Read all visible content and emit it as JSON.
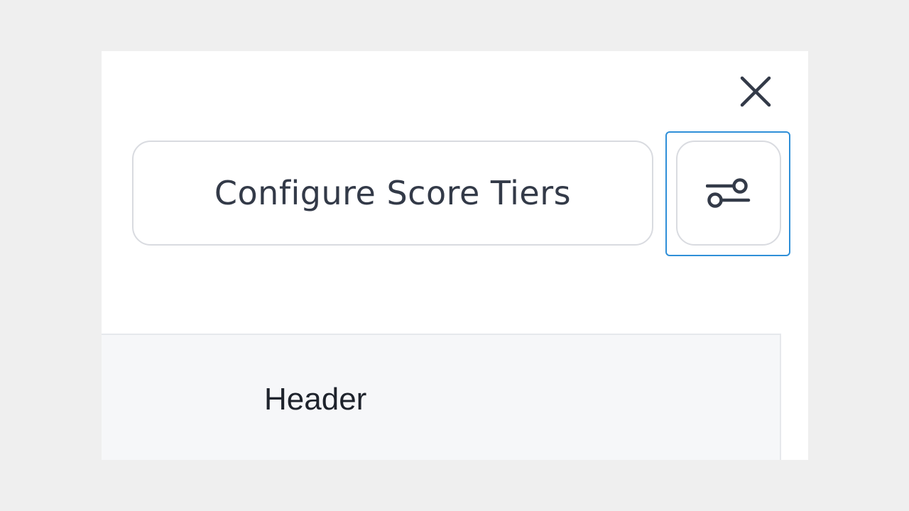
{
  "dialog": {
    "close_icon": "close-icon",
    "configure_button": {
      "label": "Configure Score Tiers"
    },
    "settings_button": {
      "icon": "sliders-icon",
      "focused": true
    },
    "table": {
      "header_label": "Header"
    }
  },
  "colors": {
    "background": "#efefef",
    "panel": "#ffffff",
    "text": "#333a48",
    "focus_ring": "#2f8fd8",
    "button_border": "#d9dbe0",
    "table_header_bg": "#f6f7f9"
  }
}
